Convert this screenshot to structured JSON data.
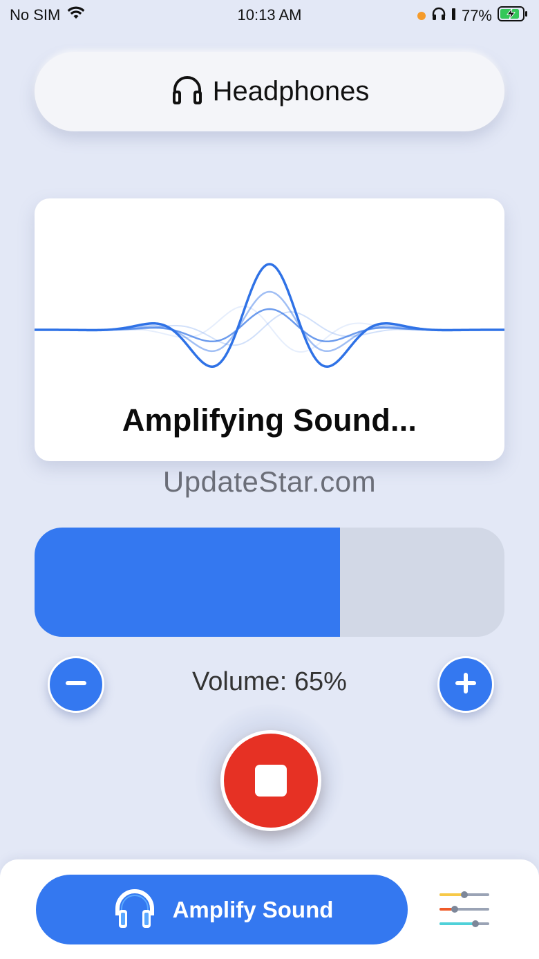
{
  "status_bar": {
    "carrier": "No SIM",
    "time": "10:13 AM",
    "battery": "77%",
    "icons": [
      "wifi-icon",
      "orange-dot",
      "headphones-icon",
      "battery-icon"
    ]
  },
  "device_selector": {
    "icon": "headphones-icon",
    "label": "Headphones"
  },
  "wave_card": {
    "title": "Amplifying Sound..."
  },
  "watermark": "UpdateStar.com",
  "volume": {
    "level": 0.65,
    "label": "Volume: 65%",
    "decrease_icon": "minus-icon",
    "increase_icon": "plus-icon"
  },
  "stop_button": {
    "icon": "stop-icon"
  },
  "bottom_bar": {
    "amplify_label": "Amplify Sound",
    "amplify_icon": "headphones-icon",
    "settings_icon": "equalizer-sliders-icon"
  },
  "colors": {
    "background": "#e3e8f6",
    "accent": "#3478f0",
    "stop": "#e63124",
    "track": "#d2d8e6",
    "wave": "#2f72e6",
    "orange_dot": "#f59b2b"
  }
}
